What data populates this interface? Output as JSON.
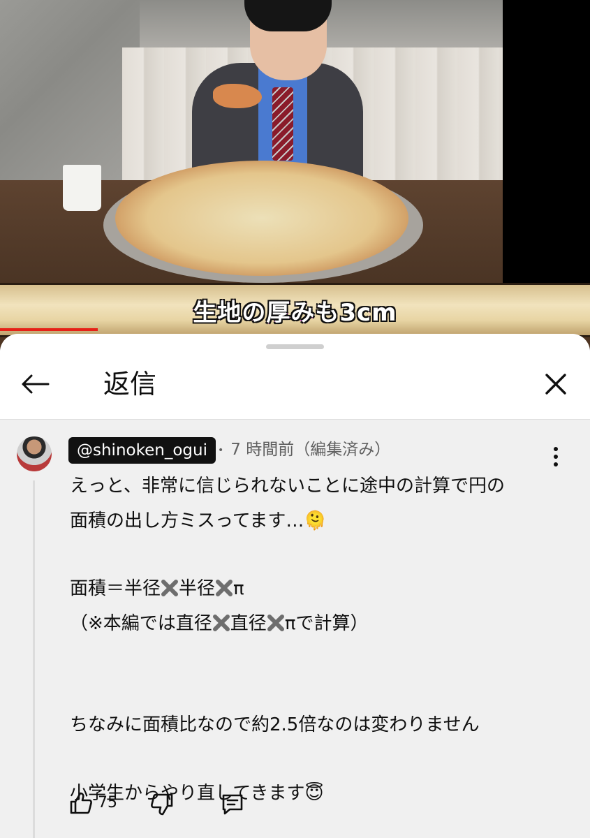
{
  "video": {
    "caption": "生地の厚みも3cm",
    "progress_fraction": 0.166
  },
  "sheet": {
    "title": "返信"
  },
  "comment": {
    "author": "@shinoken_ogui",
    "dot": "•",
    "time": "7 時間前（編集済み）",
    "lines": {
      "l1": "えっと、非常に信じられないことに途中の計算で円の",
      "l2": "面積の出し方ミスってます…🫠",
      "l3a": "面積＝半径",
      "l3b": "半径",
      "l3c": "π",
      "l4a": "（※本編では直径",
      "l4b": "直径",
      "l4c": "πで計算）",
      "l5": "ちなみに面積比なので約2.5倍なのは変わりません",
      "l6": "小学生からやり直してきます😇"
    },
    "likes": "75"
  },
  "icons": {
    "back": "arrow-left-icon",
    "close": "close-icon",
    "more": "more-vertical-icon",
    "like": "thumbs-up-icon",
    "dislike": "thumbs-down-icon",
    "reply": "reply-comment-icon",
    "cross": "heavy-multiplication-x-icon"
  },
  "colors": {
    "caption_stroke": "#c31fd0",
    "progress": "#e62117",
    "author_badge_bg": "#111111"
  }
}
